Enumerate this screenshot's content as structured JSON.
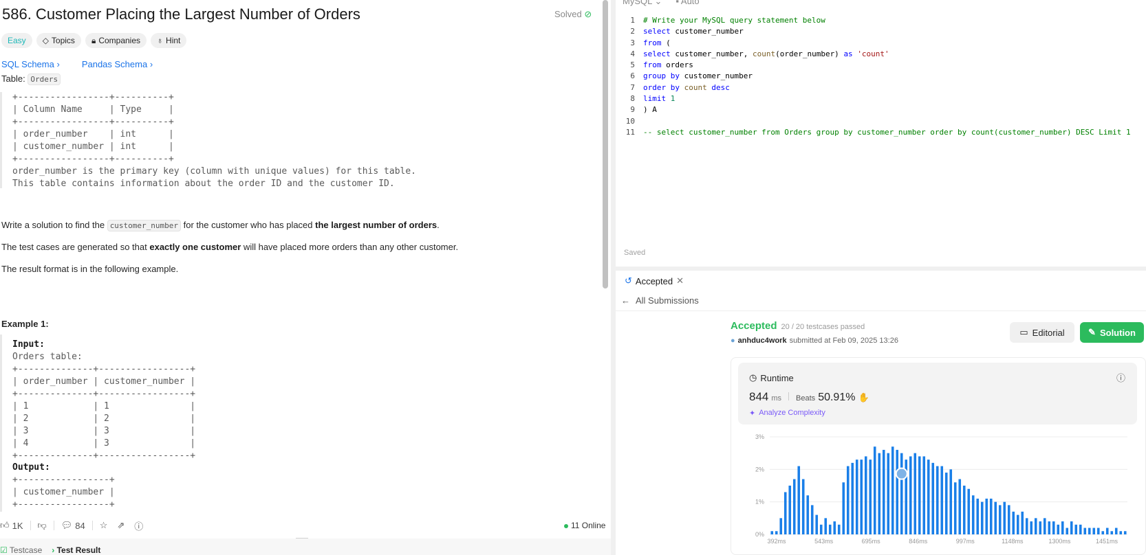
{
  "problem": {
    "title": "586. Customer Placing the Largest Number of Orders",
    "solved_label": "Solved",
    "tags": [
      "Easy",
      "Topics",
      "Companies",
      "Hint"
    ],
    "schema_links": [
      "SQL Schema",
      "Pandas Schema"
    ],
    "table_prefix": "Table:",
    "table_name": "Orders",
    "schema_block": "+-----------------+----------+\n| Column Name     | Type     |\n+-----------------+----------+\n| order_number    | int      |\n| customer_number | int      |\n+-----------------+----------+\norder_number is the primary key (column with unique values) for this table.\nThis table contains information about the order ID and the customer ID.",
    "para1_a": "Write a solution to find the ",
    "para1_code": "customer_number",
    "para1_b": " for the customer who has placed ",
    "para1_bold": "the largest number of orders",
    "para1_c": ".",
    "para2_a": "The test cases are generated so that ",
    "para2_bold": "exactly one customer",
    "para2_b": " will have placed more orders than any other customer.",
    "para3": "The result format is in the following example.",
    "example_title": "Example 1:",
    "input_label": "Input:",
    "input_block": "Orders table:\n+--------------+-----------------+\n| order_number | customer_number |\n+--------------+-----------------+\n| 1            | 1               |\n| 2            | 2               |\n| 3            | 3               |\n| 4            | 3               |\n+--------------+-----------------+",
    "output_label": "Output:",
    "output_block": "+-----------------+\n| customer_number |\n+-----------------+"
  },
  "bottom_bar": {
    "likes": "1K",
    "comments": "84",
    "online": "11 Online",
    "tabs": [
      "Testcase",
      "Test Result"
    ]
  },
  "editor": {
    "language": "MySQL",
    "mode": "Auto",
    "saved": "Saved",
    "line_numbers": [
      "1",
      "2",
      "3",
      "4",
      "5",
      "6",
      "7",
      "8",
      "9",
      "10",
      "11"
    ]
  },
  "result": {
    "tab_label": "Accepted",
    "all_submissions": "All Submissions",
    "status": "Accepted",
    "testcases": "20 / 20 testcases passed",
    "user": "anhduc4work",
    "submitted": "submitted at Feb 09, 2025 13:26",
    "editorial": "Editorial",
    "solution": "Solution",
    "runtime_label": "Runtime",
    "runtime_value": "844",
    "runtime_unit": "ms",
    "beats_label": "Beats",
    "beats_value": "50.91%",
    "analyze": "Analyze Complexity"
  },
  "colors": {
    "accent": "#2cbb5d",
    "link": "#1a73e8",
    "bar": "#1a7fe8"
  },
  "chart_data": {
    "type": "bar",
    "y_ticks": [
      "3%",
      "2%",
      "1%",
      "0%"
    ],
    "x_ticks": [
      "392ms",
      "543ms",
      "695ms",
      "846ms",
      "997ms",
      "1148ms",
      "1300ms",
      "1451ms"
    ],
    "ylim": [
      0,
      3
    ],
    "values": [
      0.1,
      0.1,
      0.5,
      1.3,
      1.5,
      1.7,
      2.1,
      1.7,
      1.2,
      0.9,
      0.6,
      0.3,
      0.5,
      0.3,
      0.4,
      0.3,
      1.6,
      2.1,
      2.2,
      2.3,
      2.3,
      2.4,
      2.3,
      2.7,
      2.5,
      2.6,
      2.5,
      2.7,
      2.6,
      2.5,
      2.3,
      2.4,
      2.5,
      2.4,
      2.4,
      2.3,
      2.2,
      2.1,
      2.1,
      1.9,
      2.0,
      1.6,
      1.7,
      1.5,
      1.4,
      1.2,
      1.1,
      1.0,
      1.1,
      1.1,
      1.0,
      0.9,
      1.0,
      0.9,
      0.7,
      0.6,
      0.7,
      0.5,
      0.4,
      0.5,
      0.4,
      0.5,
      0.4,
      0.4,
      0.3,
      0.4,
      0.2,
      0.4,
      0.3,
      0.3,
      0.2,
      0.2,
      0.2,
      0.2,
      0.1,
      0.2,
      0.1,
      0.2,
      0.1,
      0.1
    ],
    "highlight_index": 29
  }
}
